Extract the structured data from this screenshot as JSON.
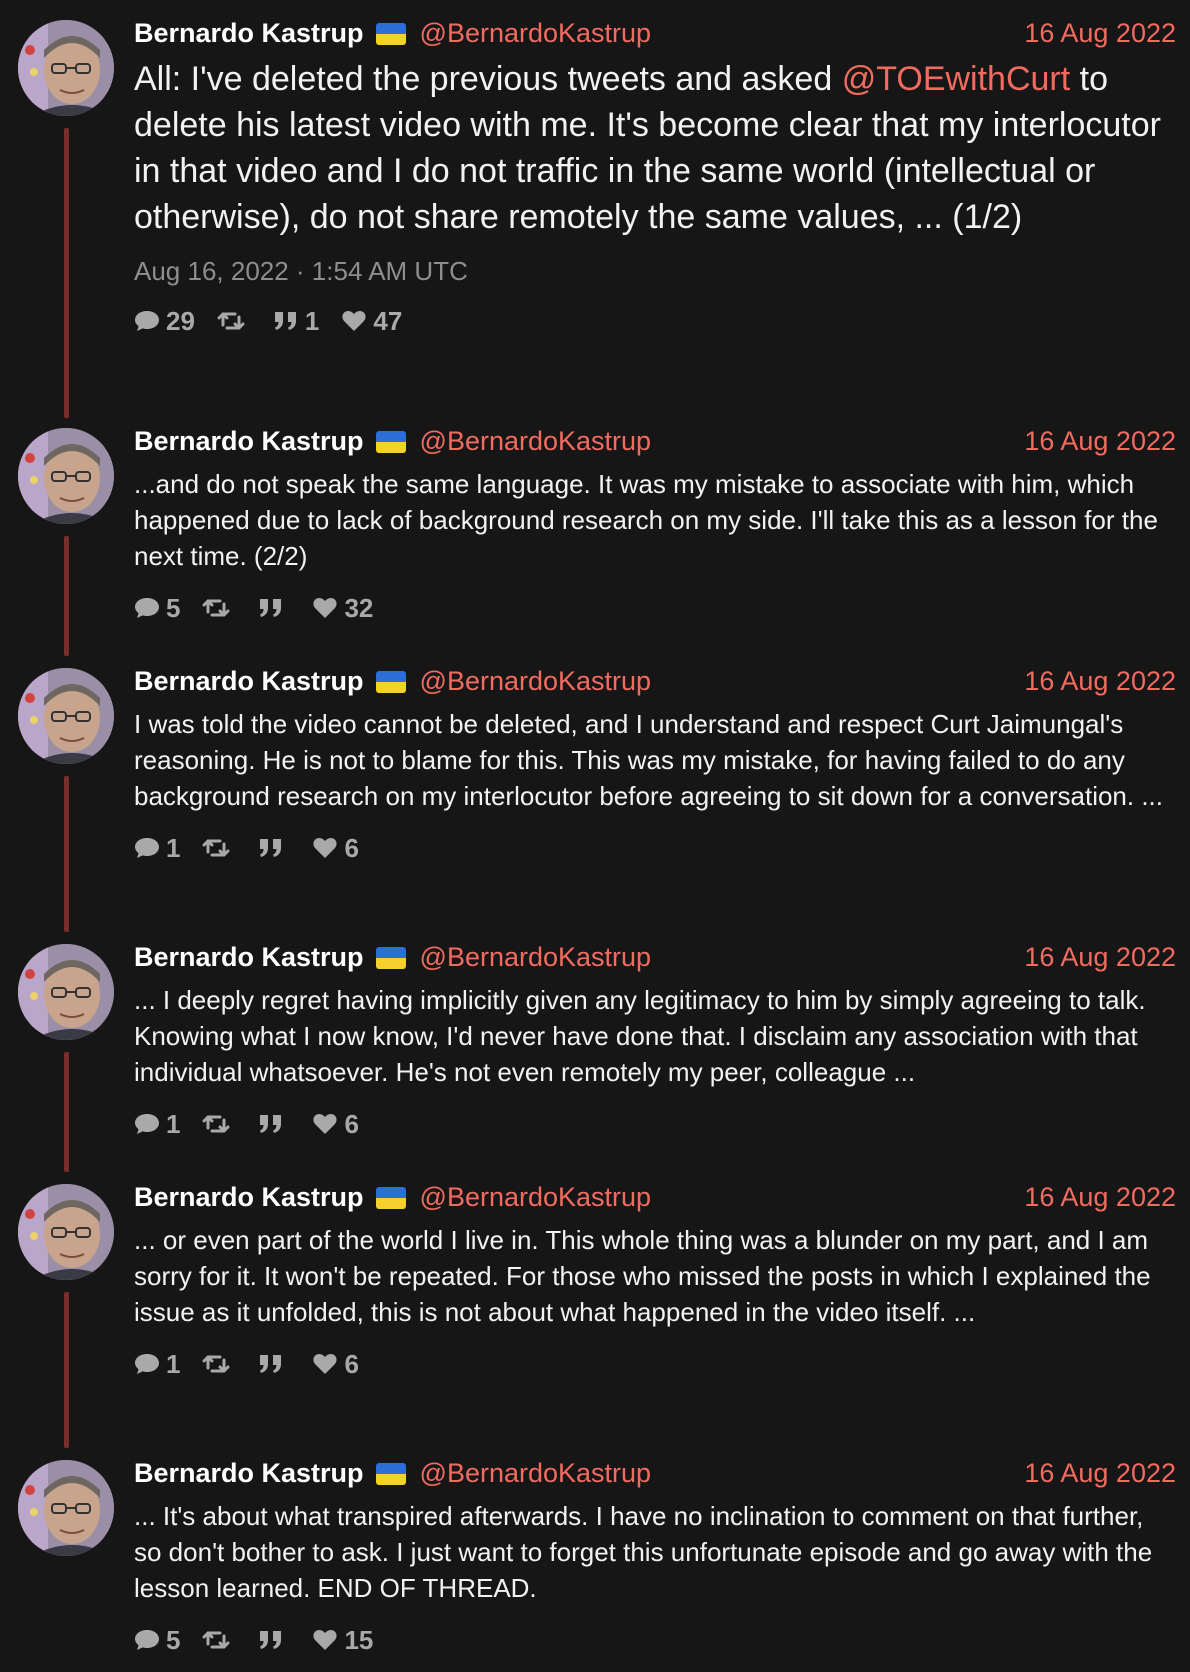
{
  "author": {
    "name": "Bernardo Kastrup",
    "handle": "@BernardoKastrup"
  },
  "colors": {
    "background": "#161616",
    "accent": "#f26b5f",
    "thread_line": "#7a2e2a",
    "muted": "#8e8e8e",
    "stats": "#a9a9a9"
  },
  "icons": {
    "reply": "comment-icon",
    "retweet": "retweet-icon",
    "quote": "quote-icon",
    "like": "heart-icon",
    "flag": "ukraine-flag-icon"
  },
  "tweets": [
    {
      "date": "16 Aug 2022",
      "text_before": "All: I've deleted the previous tweets and asked ",
      "mention": "@TOEwithCurt",
      "text_after": " to delete his latest video with me. It's become clear that my interlocutor in that video and I do not traffic in the same world (intellectual or otherwise), do not share remotely the same values, ... (1/2)",
      "timestamp": "Aug 16, 2022 · 1:54 AM UTC",
      "replies": "29",
      "retweets": "",
      "quotes": "1",
      "likes": "47"
    },
    {
      "date": "16 Aug 2022",
      "text": "...and do not speak the same language. It was my mistake to associate with him, which happened due to lack of background research on my side. I'll take this as a lesson for the next time. (2/2)",
      "replies": "5",
      "retweets": "",
      "quotes": "",
      "likes": "32"
    },
    {
      "date": "16 Aug 2022",
      "text": "I was told the video cannot be deleted, and I understand and respect Curt Jaimungal's reasoning. He is not to blame for this. This was my mistake, for having failed to do any background research on my interlocutor before agreeing to sit down for a conversation. ...",
      "replies": "1",
      "retweets": "",
      "quotes": "",
      "likes": "6"
    },
    {
      "date": "16 Aug 2022",
      "text": "... I deeply regret having implicitly given any legitimacy to him by simply agreeing to talk. Knowing what I now know, I'd never have done that. I disclaim any association with that individual whatsoever. He's not even remotely my peer, colleague ...",
      "replies": "1",
      "retweets": "",
      "quotes": "",
      "likes": "6"
    },
    {
      "date": "16 Aug 2022",
      "text": "... or even part of the world I live in. This whole thing was a blunder on my part, and I am sorry for it. It won't be repeated. For those who missed the posts in which I explained the issue as it unfolded, this is not about what happened in the video itself. ...",
      "replies": "1",
      "retweets": "",
      "quotes": "",
      "likes": "6"
    },
    {
      "date": "16 Aug 2022",
      "text": "... It's about what transpired afterwards. I have no inclination to comment on that further, so don't bother to ask. I just want to forget this unfortunate episode and go away with the lesson learned. END OF THREAD.",
      "replies": "5",
      "retweets": "",
      "quotes": "",
      "likes": "15"
    }
  ]
}
